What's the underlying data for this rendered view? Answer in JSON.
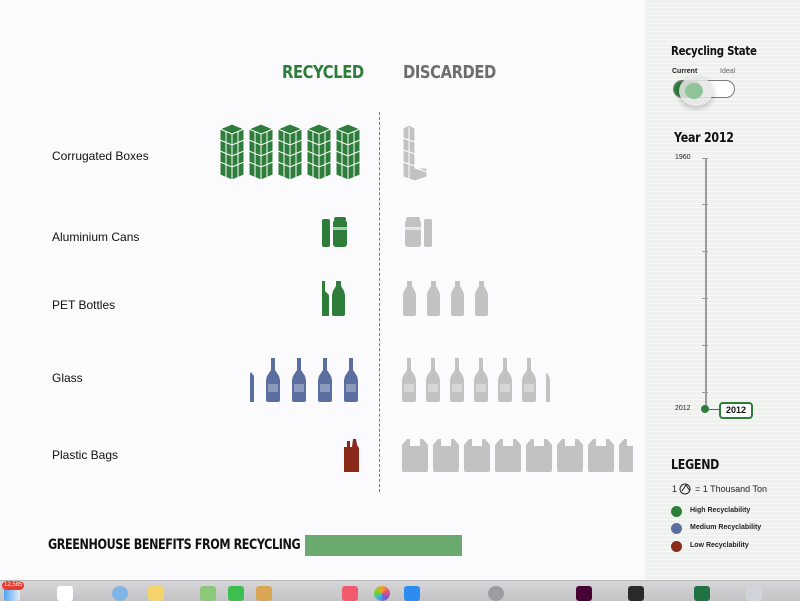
{
  "header": {
    "recycled": "RECYCLED",
    "discarded": "DISCARDED"
  },
  "rows": [
    {
      "label": "Corrugated Boxes",
      "recycled_icons": 5,
      "discarded_icons": 1,
      "recycled_color": "#2e7d3a",
      "discarded_color": "#c2c2c2",
      "recyclability": "High"
    },
    {
      "label": "Aluminium Cans",
      "recycled_icons": 1.5,
      "discarded_icons": 1.5,
      "recycled_color": "#2e7d3a",
      "discarded_color": "#c2c2c2",
      "recyclability": "High"
    },
    {
      "label": "PET Bottles",
      "recycled_icons": 1.5,
      "discarded_icons": 4,
      "recycled_color": "#2e7d3a",
      "discarded_color": "#c2c2c2",
      "recyclability": "High"
    },
    {
      "label": "Glass",
      "recycled_icons": 4.2,
      "discarded_icons": 6.2,
      "recycled_color": "#5a6ea0",
      "discarded_color": "#c2c2c2",
      "recyclability": "Medium"
    },
    {
      "label": "Plastic Bags",
      "recycled_icons": 0.5,
      "discarded_icons": 7.5,
      "recycled_color": "#8b2a1a",
      "discarded_color": "#c2c2c2",
      "recyclability": "Low"
    }
  ],
  "greenhouse": {
    "label": "GREENHOUSE BENEFITS FROM RECYCLING",
    "bar_color": "#6aaa6e"
  },
  "panel": {
    "state_title": "Recycling State",
    "toggle_current": "Current",
    "toggle_ideal": "Ideal",
    "toggle_selected": "Current",
    "year_title": "Year 2012",
    "slider_top": "1960",
    "slider_bottom": "2012",
    "slider_value": "2012",
    "legend_title": "LEGEND",
    "legend_unit_left": "1",
    "legend_unit_right": "= 1 Thousand Ton",
    "legend_items": [
      {
        "label": "High Recyclability",
        "color": "#2e7d3a"
      },
      {
        "label": "Medium Recyclability",
        "color": "#5a6ea0"
      },
      {
        "label": "Low Recyclability",
        "color": "#8b2a1a"
      }
    ]
  },
  "dock": {
    "badge": "12,585",
    "items": [
      "finder-icon",
      "calendar-icon",
      "safari-icon",
      "maps-icon",
      "facetime-icon",
      "photos-icon",
      "music-icon",
      "appstore-icon",
      "terminal-icon",
      "xd-icon",
      "excel-icon",
      "launchpad-icon"
    ]
  }
}
